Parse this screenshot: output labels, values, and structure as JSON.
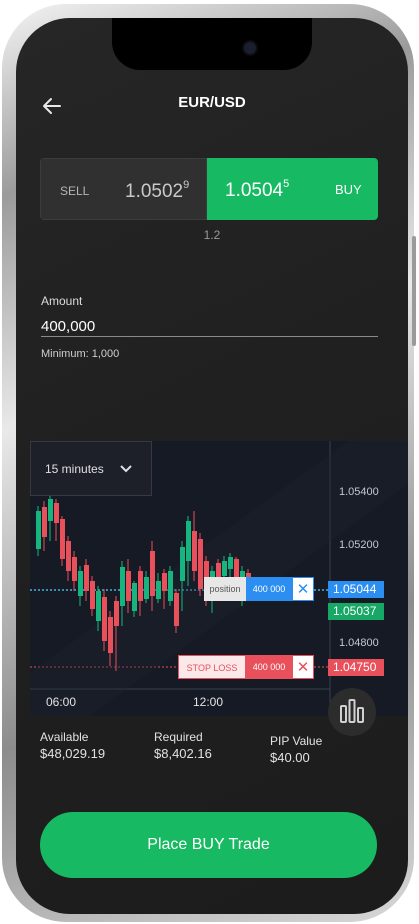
{
  "header": {
    "title": "EUR/USD"
  },
  "quote": {
    "sell_label": "SELL",
    "sell_price_main": "1.0502",
    "sell_price_sup": "9",
    "buy_price_main": "1.0504",
    "buy_price_sup": "5",
    "buy_label": "BUY",
    "spread": "1.2"
  },
  "amount": {
    "label": "Amount",
    "value": "400,000",
    "minimum": "Minimum: 1,000"
  },
  "chart": {
    "timeframe": "15 minutes",
    "y_ticks": [
      "1.05400",
      "1.05200",
      "1.04800"
    ],
    "x_ticks": [
      "06:00",
      "12:00"
    ],
    "price_tags": {
      "buy": "1.05044",
      "sell": "1.05037",
      "stop": "1.04750"
    },
    "position_label": "position",
    "position_amount": "400 000",
    "stop_loss_label": "STOP LOSS",
    "stop_loss_amount": "400 000",
    "colors": {
      "up": "#16b57f",
      "down": "#e8505b",
      "blue": "#2d8ef2",
      "green": "#17b962",
      "red": "#e8505b"
    }
  },
  "stats": {
    "available_label": "Available",
    "available_value": "$48,029.19",
    "required_label": "Required",
    "required_value": "$8,402.16",
    "pip_label": "PIP Value",
    "pip_value": "$40.00"
  },
  "action": {
    "place_label": "Place BUY Trade"
  },
  "icons": {
    "back": "arrow-left-icon",
    "dropdown": "chevron-down-icon",
    "chart_toggle": "bar-chart-icon",
    "close": "close-icon"
  },
  "colors": {
    "accent": "#17b962",
    "background": "#222222"
  }
}
